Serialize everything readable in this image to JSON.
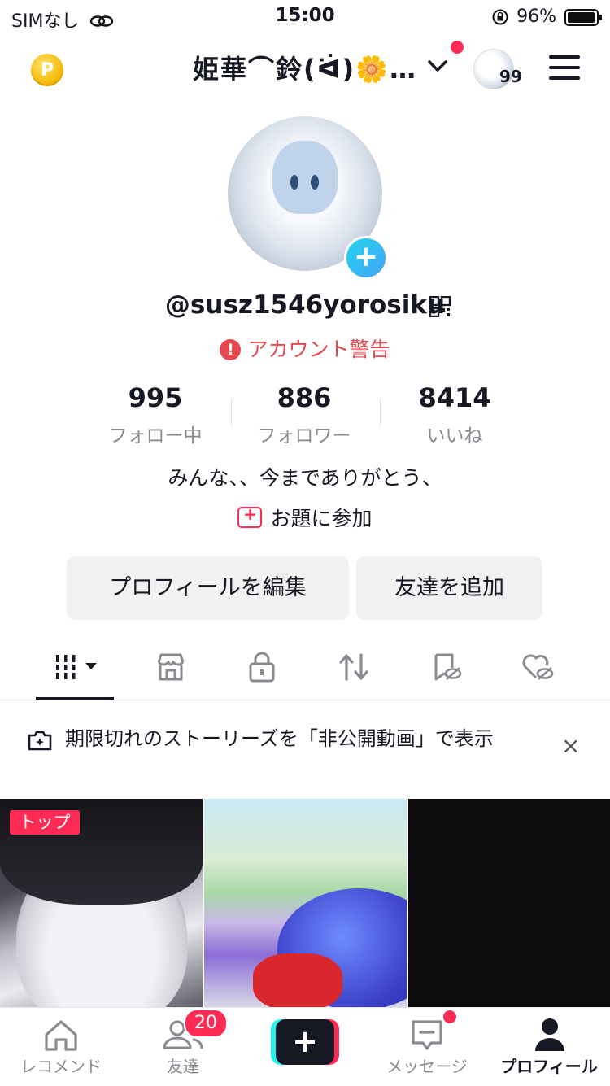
{
  "status_bar": {
    "carrier": "SIMなし",
    "time": "15:00",
    "battery": "96%",
    "battery_level": 0.96
  },
  "header": {
    "title": "姫華⌒鈴(ᐛ)🌼…",
    "mini_avatar_badge": "99",
    "coin_label": "P"
  },
  "profile": {
    "handle": "@susz1546yorosiku",
    "warning": "アカウント警告",
    "stats": [
      {
        "value": "995",
        "label": "フォロー中"
      },
      {
        "value": "886",
        "label": "フォロワー"
      },
      {
        "value": "8414",
        "label": "いいね"
      }
    ],
    "bio": "みんな、、今までありがとう、",
    "topic": "お題に参加"
  },
  "actions": {
    "edit": "プロフィールを編集",
    "add_friend": "友達を追加"
  },
  "tabs": [
    "videos-grid-icon",
    "shop-icon",
    "lock-icon",
    "repost-icon",
    "favorites-hidden-icon",
    "liked-hidden-icon"
  ],
  "notice": {
    "text": "期限切れのストーリーズを「非公開動画」で表示",
    "close": "×"
  },
  "grid": {
    "top_badge": "トップ"
  },
  "nav": {
    "home": "レコメンド",
    "friends": "友達",
    "friends_badge": "20",
    "create": "+",
    "messages": "メッセージ",
    "profile": "プロフィール"
  },
  "colors": {
    "accent": "#fe2c55",
    "warning": "#e5484d",
    "cyan": "#25f4ee"
  }
}
